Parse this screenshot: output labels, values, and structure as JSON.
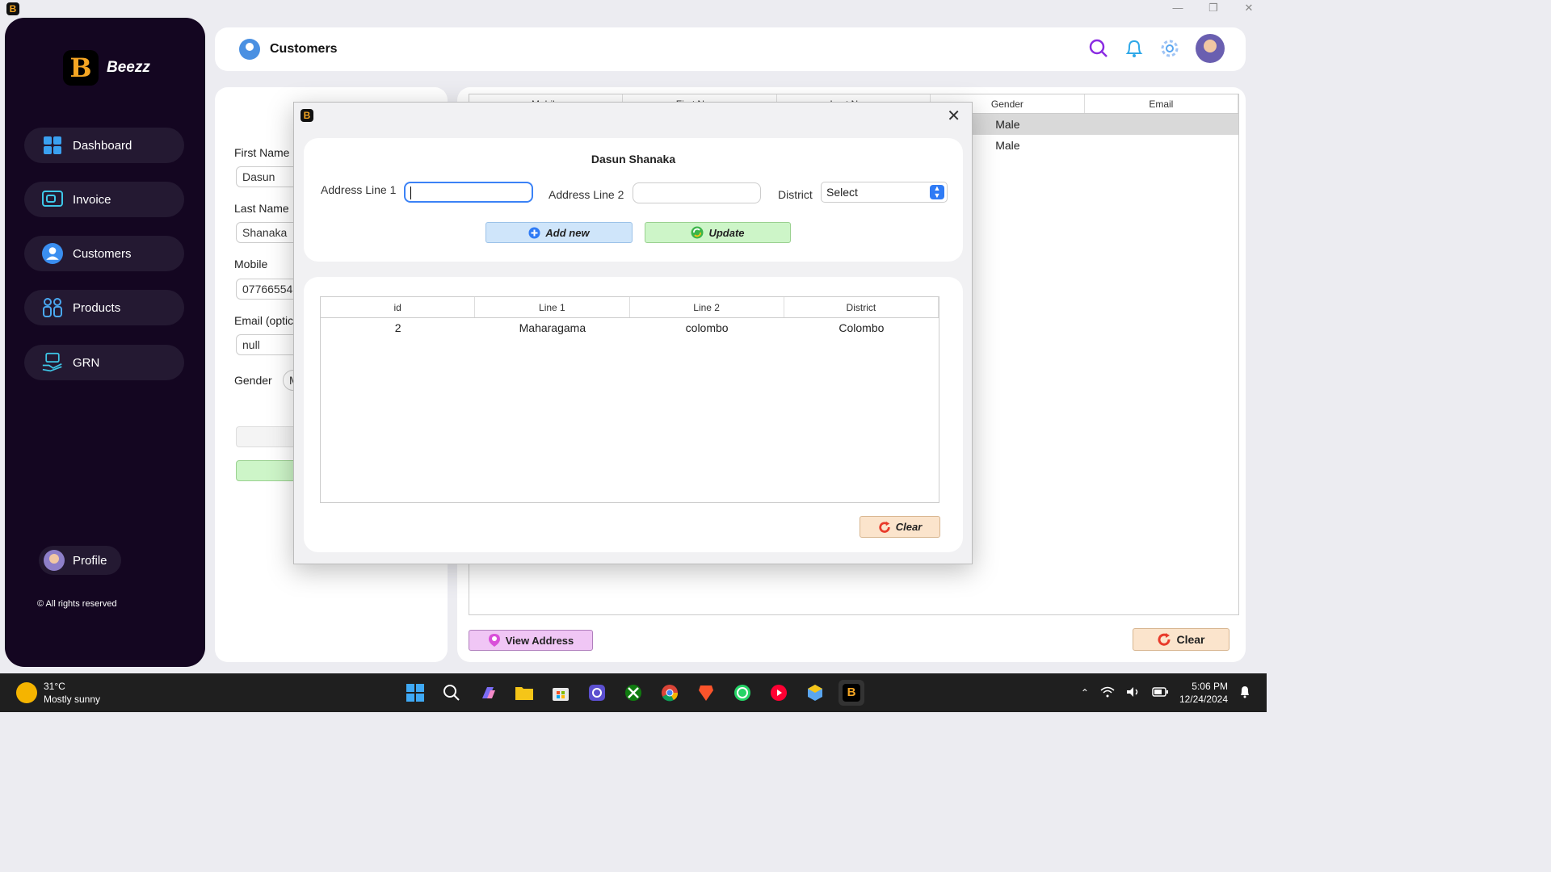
{
  "app": {
    "name": "Beezz"
  },
  "sidebar": {
    "items": [
      {
        "label": "Dashboard"
      },
      {
        "label": "Invoice"
      },
      {
        "label": "Customers"
      },
      {
        "label": "Products"
      },
      {
        "label": "GRN"
      }
    ],
    "profile_label": "Profile",
    "rights": "© All rights reserved"
  },
  "header": {
    "title": "Customers"
  },
  "form": {
    "first_name_label": "First Name",
    "first_name_value": "Dasun",
    "last_name_label": "Last Name",
    "last_name_value": "Shanaka",
    "mobile_label": "Mobile",
    "mobile_value": "07766554",
    "email_label": "Email (optic",
    "email_value": "null",
    "gender_label": "Gender",
    "gender_value": "M"
  },
  "customers_table": {
    "columns": [
      "Mobile",
      "First Name",
      "Last Name",
      "Gender",
      "Email"
    ],
    "rows": [
      {
        "gender": "Male",
        "selected": true
      },
      {
        "gender": "Male",
        "selected": false
      }
    ]
  },
  "buttons": {
    "view_address": "View Address",
    "clear": "Clear"
  },
  "modal": {
    "customer_name": "Dasun Shanaka",
    "address_line1_label": "Address Line 1",
    "address_line2_label": "Address Line 2",
    "district_label": "District",
    "district_value": "Select",
    "add_new": "Add new",
    "update": "Update",
    "clear": "Clear",
    "table": {
      "columns": [
        "id",
        "Line 1",
        "Line 2",
        "District"
      ],
      "rows": [
        [
          "2",
          "Maharagama",
          "colombo",
          "Colombo"
        ]
      ]
    }
  },
  "taskbar": {
    "temperature": "31°C",
    "weather": "Mostly sunny",
    "time": "5:06 PM",
    "date": "12/24/2024"
  },
  "colors": {
    "sidebar_bg": "#140621",
    "nav_item_bg": "#241932",
    "accent_blue": "#2f7bf5",
    "brand_gold": "#f5a623"
  }
}
